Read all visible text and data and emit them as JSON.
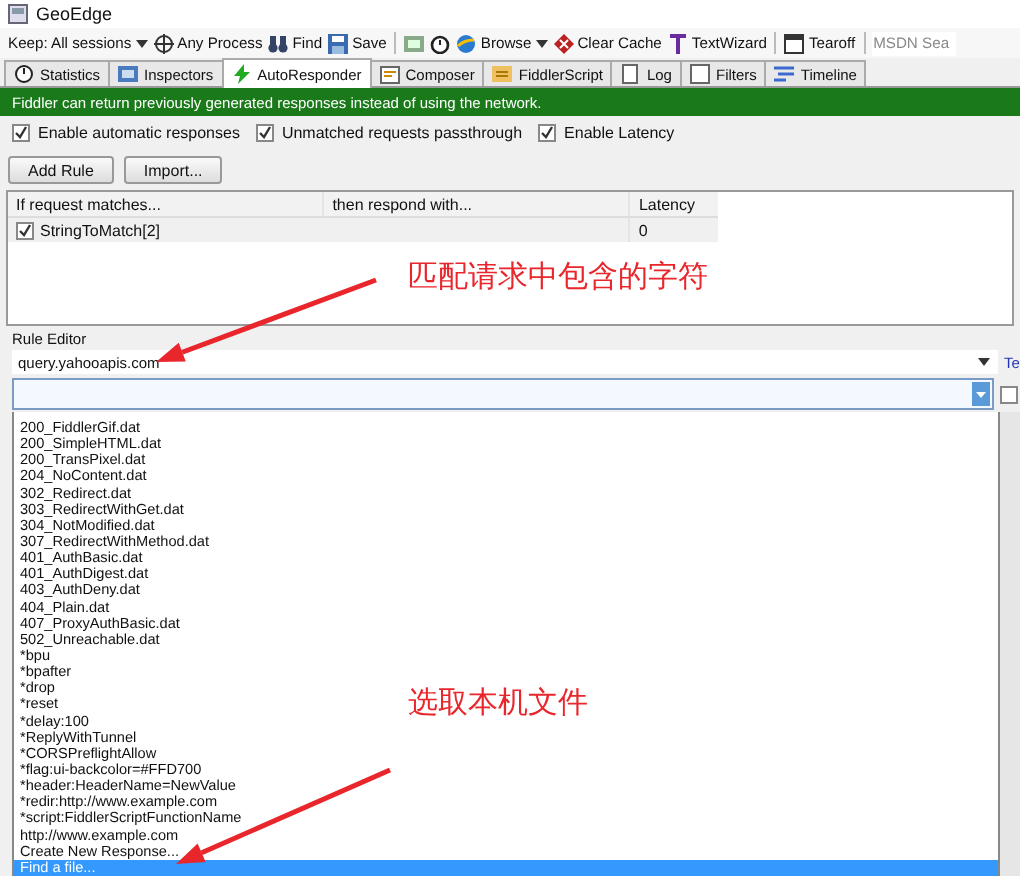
{
  "window": {
    "title": "GeoEdge"
  },
  "toolbar": [
    {
      "kind": "dropdown",
      "label": "Keep: All sessions"
    },
    {
      "kind": "button",
      "label": "Any Process"
    },
    {
      "kind": "button",
      "label": "Find"
    },
    {
      "kind": "button",
      "label": "Save"
    },
    {
      "kind": "icon"
    },
    {
      "kind": "icon"
    },
    {
      "kind": "dropdown",
      "label": "Browse"
    },
    {
      "kind": "button",
      "label": "Clear Cache"
    },
    {
      "kind": "button",
      "label": "TextWizard"
    },
    {
      "kind": "button",
      "label": "Tearoff"
    },
    {
      "kind": "search",
      "placeholder": "MSDN Sea"
    }
  ],
  "tabs": [
    {
      "label": "Statistics",
      "selected": false
    },
    {
      "label": "Inspectors",
      "selected": false
    },
    {
      "label": "AutoResponder",
      "selected": true
    },
    {
      "label": "Composer",
      "selected": false
    },
    {
      "label": "FiddlerScript",
      "selected": false
    },
    {
      "label": "Log",
      "selected": false
    },
    {
      "label": "Filters",
      "selected": false
    },
    {
      "label": "Timeline",
      "selected": false
    }
  ],
  "banner": "Fiddler can return previously generated responses instead of using the network.",
  "options": [
    {
      "label": "Enable automatic responses",
      "checked": true
    },
    {
      "label": "Unmatched requests passthrough",
      "checked": true
    },
    {
      "label": "Enable Latency",
      "checked": true
    }
  ],
  "buttons": [
    "Add Rule",
    "Import..."
  ],
  "rules_table": {
    "columns": [
      "If request matches...",
      "then respond with...",
      "Latency"
    ],
    "rows": [
      {
        "checked": true,
        "match": "StringToMatch[2]",
        "latency": "0"
      }
    ]
  },
  "rule_editor": {
    "label": "Rule Editor",
    "match_value": "query.yahooapis.com",
    "link": "Te",
    "side_checkbox_checked": false,
    "response_dropdown": {
      "expanded": true,
      "options": [
        {
          "label": "200_FiddlerGif.dat",
          "selected": false
        },
        {
          "label": "200_SimpleHTML.dat",
          "selected": false
        },
        {
          "label": "200_TransPixel.dat",
          "selected": false
        },
        {
          "label": "204_NoContent.dat",
          "selected": false
        },
        {
          "label": "302_Redirect.dat",
          "selected": false
        },
        {
          "label": "303_RedirectWithGet.dat",
          "selected": false
        },
        {
          "label": "304_NotModified.dat",
          "selected": false
        },
        {
          "label": "307_RedirectWithMethod.dat",
          "selected": false
        },
        {
          "label": "401_AuthBasic.dat",
          "selected": false
        },
        {
          "label": "401_AuthDigest.dat",
          "selected": false
        },
        {
          "label": "403_AuthDeny.dat",
          "selected": false
        },
        {
          "label": "404_Plain.dat",
          "selected": false
        },
        {
          "label": "407_ProxyAuthBasic.dat",
          "selected": false
        },
        {
          "label": "502_Unreachable.dat",
          "selected": false
        },
        {
          "label": "*bpu",
          "selected": false
        },
        {
          "label": "*bpafter",
          "selected": false
        },
        {
          "label": "*drop",
          "selected": false
        },
        {
          "label": "*reset",
          "selected": false
        },
        {
          "label": "*delay:100",
          "selected": false
        },
        {
          "label": "*ReplyWithTunnel",
          "selected": false
        },
        {
          "label": "*CORSPreflightAllow",
          "selected": false
        },
        {
          "label": "*flag:ui-backcolor=#FFD700",
          "selected": false
        },
        {
          "label": "*header:HeaderName=NewValue",
          "selected": false
        },
        {
          "label": "*redir:http://www.example.com",
          "selected": false
        },
        {
          "label": "*script:FiddlerScriptFunctionName",
          "selected": false
        },
        {
          "label": "http://www.example.com",
          "selected": false
        },
        {
          "label": "Create New Response...",
          "selected": false
        },
        {
          "label": "Find a file...",
          "selected": true
        }
      ]
    }
  },
  "annotations": [
    {
      "text": "匹配请求中包含的字符"
    },
    {
      "text": "选取本机文件"
    }
  ]
}
